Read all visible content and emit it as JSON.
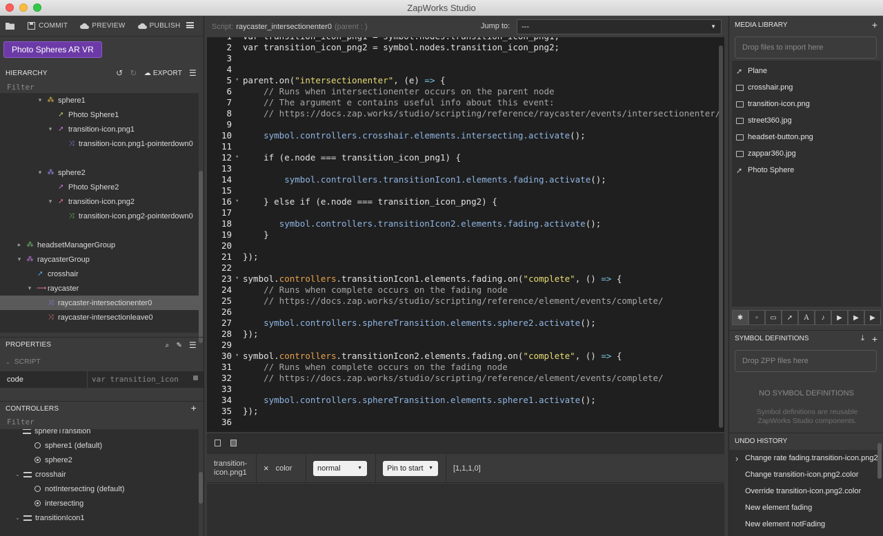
{
  "window": {
    "title": "ZapWorks Studio"
  },
  "toolbar": {
    "commit": "COMMIT",
    "preview": "PREVIEW",
    "publish": "PUBLISH"
  },
  "project": {
    "name": "Photo Spheres AR VR"
  },
  "hierarchy": {
    "title": "HIERARCHY",
    "export": "EXPORT",
    "filter": "Filter",
    "nodes": [
      {
        "label": "sphere1",
        "indent": 3,
        "twisty": "▾",
        "icon": "group-icon",
        "color": "#e0b84a"
      },
      {
        "label": "Photo Sphere1",
        "indent": 4,
        "twisty": "",
        "icon": "rocket-icon",
        "color": "#b7c86a"
      },
      {
        "label": "transition-icon.png1",
        "indent": 4,
        "twisty": "▾",
        "icon": "rocket-icon",
        "color": "#c678dd"
      },
      {
        "label": "transition-icon.png1-pointerdown0",
        "indent": 5,
        "twisty": "",
        "icon": "shuffle-icon",
        "color": "#9c7cf0"
      },
      {
        "label": "",
        "indent": 0,
        "twisty": "",
        "icon": "",
        "color": ""
      },
      {
        "label": "sphere2",
        "indent": 3,
        "twisty": "▾",
        "icon": "group-icon",
        "color": "#9d8df0"
      },
      {
        "label": "Photo Sphere2",
        "indent": 4,
        "twisty": "",
        "icon": "rocket-icon",
        "color": "#c678dd"
      },
      {
        "label": "transition-icon.png2",
        "indent": 4,
        "twisty": "▾",
        "icon": "rocket-icon",
        "color": "#e07a8a"
      },
      {
        "label": "transition-icon.png2-pointerdown0",
        "indent": 5,
        "twisty": "",
        "icon": "shuffle-icon",
        "color": "#6dbb6d"
      },
      {
        "label": "",
        "indent": 0,
        "twisty": "",
        "icon": "",
        "color": ""
      },
      {
        "label": "headsetManagerGroup",
        "indent": 1,
        "twisty": "▸",
        "icon": "group-icon",
        "color": "#6dbb6d"
      },
      {
        "label": "raycasterGroup",
        "indent": 1,
        "twisty": "▾",
        "icon": "group-icon",
        "color": "#c678dd"
      },
      {
        "label": "crosshair",
        "indent": 2,
        "twisty": "",
        "icon": "rocket-icon",
        "color": "#5aa8e6"
      },
      {
        "label": "raycaster",
        "indent": 2,
        "twisty": "▾",
        "icon": "arrow-icon",
        "color": "#e07a8a"
      },
      {
        "label": "raycaster-intersectionenter0",
        "indent": 3,
        "twisty": "",
        "icon": "shuffle-icon",
        "color": "#9c7cf0",
        "selected": true
      },
      {
        "label": "raycaster-intersectionleave0",
        "indent": 3,
        "twisty": "",
        "icon": "shuffle-icon",
        "color": "#e07a8a"
      }
    ]
  },
  "properties": {
    "title": "PROPERTIES",
    "section": "SCRIPT",
    "key": "code",
    "value": "var transition_icon"
  },
  "controllers": {
    "title": "CONTROLLERS",
    "filter": "Filter",
    "partial_label": "sphereTransition",
    "items": [
      {
        "type": "radio",
        "label": "sphere1 (default)",
        "on": false
      },
      {
        "type": "radio",
        "label": "sphere2",
        "on": true
      },
      {
        "type": "group",
        "label": "crosshair"
      },
      {
        "type": "radio",
        "label": "notIntersecting (default)",
        "on": false
      },
      {
        "type": "radio",
        "label": "intersecting",
        "on": true
      },
      {
        "type": "group",
        "label": "transitionIcon1"
      }
    ]
  },
  "script": {
    "label": "Script:",
    "name": "raycaster_intersectionenter0",
    "parent": "(parent : )",
    "jump_label": "Jump to:",
    "jump_value": "---"
  },
  "timeline": {
    "target": "transition-icon.png1",
    "property": "color",
    "ease": "normal",
    "pin": "Pin to start",
    "value": "[1,1,1,0]"
  },
  "media": {
    "title": "MEDIA LIBRARY",
    "drop": "Drop files to import here",
    "items": [
      {
        "label": "Plane",
        "icon": "rocket-icon"
      },
      {
        "label": "crosshair.png",
        "icon": "image-icon"
      },
      {
        "label": "transition-icon.png",
        "icon": "image-icon"
      },
      {
        "label": "street360.jpg",
        "icon": "image-icon"
      },
      {
        "label": "headset-button.png",
        "icon": "image-icon"
      },
      {
        "label": "zappar360.jpg",
        "icon": "image-icon"
      },
      {
        "label": "Photo Sphere",
        "icon": "rocket-icon"
      }
    ]
  },
  "symbols": {
    "title": "SYMBOL DEFINITIONS",
    "drop": "Drop ZPP files here",
    "empty_title": "NO SYMBOL DEFINITIONS",
    "empty_desc": "Symbol definitions are reusable ZapWorks Studio components."
  },
  "undo": {
    "title": "UNDO HISTORY",
    "items": [
      "Change rate fading.transition-icon.png2",
      "Change transition-icon.png2.color",
      "Override transition-icon.png2.color",
      "New element fading",
      "New element notFading"
    ]
  }
}
